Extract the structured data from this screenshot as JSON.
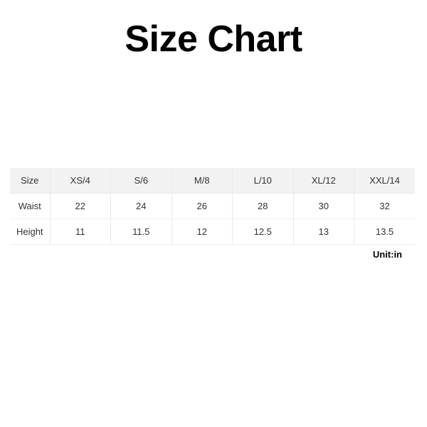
{
  "page": {
    "title": "Size Chart",
    "background_color": "#ffffff",
    "text_color": "#333333"
  },
  "unit_note": "Unit:in",
  "table": {
    "header_background": "#f2f2f2",
    "border_color": "#eaeaea",
    "columns": [
      "Size",
      "XS/4",
      "S/6",
      "M/8",
      "L/10",
      "XL/12",
      "XXL/14"
    ],
    "rows": [
      {
        "label": "Waist",
        "values": [
          "22",
          "24",
          "26",
          "28",
          "30",
          "32"
        ]
      },
      {
        "label": "Height",
        "values": [
          "11",
          "11.5",
          "12",
          "12.5",
          "13",
          "13.5"
        ]
      }
    ]
  },
  "chart_data": {
    "type": "table",
    "title": "Size Chart",
    "columns": [
      "Size",
      "XS/4",
      "S/6",
      "M/8",
      "L/10",
      "XL/12",
      "XXL/14"
    ],
    "rows": [
      [
        "Waist",
        "22",
        "24",
        "26",
        "28",
        "30",
        "32"
      ],
      [
        "Height",
        "11",
        "11.5",
        "12",
        "12.5",
        "13",
        "13.5"
      ]
    ],
    "series": [
      {
        "name": "Waist",
        "values": [
          22,
          24,
          26,
          28,
          30,
          32
        ]
      },
      {
        "name": "Height",
        "values": [
          11,
          11.5,
          12,
          12.5,
          13,
          13.5
        ]
      }
    ],
    "categories": [
      "XS/4",
      "S/6",
      "M/8",
      "L/10",
      "XL/12",
      "XXL/14"
    ],
    "units": "in",
    "annotations": [
      "Unit:in"
    ]
  }
}
